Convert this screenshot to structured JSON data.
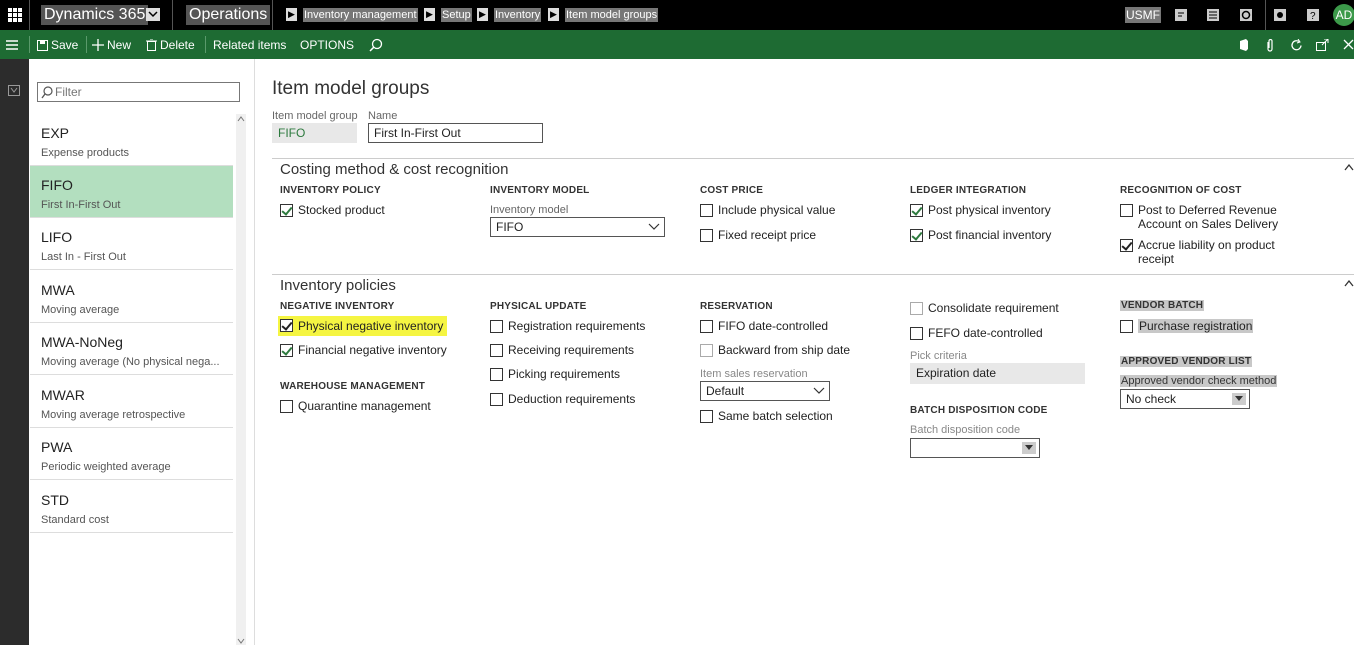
{
  "topbar": {
    "product": "Dynamics 365",
    "app": "Operations",
    "breadcrumb": [
      "Inventory management",
      "Setup",
      "Inventory",
      "Item model groups"
    ],
    "company": "USMF",
    "user_initials": "AD"
  },
  "actions": {
    "save": "Save",
    "new": "New",
    "delete": "Delete",
    "related": "Related items",
    "options": "OPTIONS"
  },
  "list": {
    "filter_placeholder": "Filter",
    "items": [
      {
        "code": "EXP",
        "name": "Expense products"
      },
      {
        "code": "FIFO",
        "name": "First In-First Out"
      },
      {
        "code": "LIFO",
        "name": "Last In - First Out"
      },
      {
        "code": "MWA",
        "name": "Moving average"
      },
      {
        "code": "MWA-NoNeg",
        "name": "Moving average (No physical nega..."
      },
      {
        "code": "MWAR",
        "name": "Moving average retrospective"
      },
      {
        "code": "PWA",
        "name": "Periodic weighted average"
      },
      {
        "code": "STD",
        "name": "Standard cost"
      }
    ],
    "selected": "FIFO"
  },
  "page": {
    "title": "Item model groups",
    "group_label": "Item model group",
    "group_value": "FIFO",
    "name_label": "Name",
    "name_value": "First In-First Out"
  },
  "costing": {
    "title": "Costing method & cost recognition",
    "inventory_policy": {
      "header": "INVENTORY POLICY",
      "stocked": "Stocked product"
    },
    "inventory_model": {
      "header": "INVENTORY MODEL",
      "label": "Inventory model",
      "value": "FIFO"
    },
    "cost_price": {
      "header": "COST PRICE",
      "include_physical": "Include physical value",
      "fixed_receipt": "Fixed receipt price"
    },
    "ledger": {
      "header": "LEDGER INTEGRATION",
      "post_physical": "Post physical inventory",
      "post_financial": "Post financial inventory"
    },
    "recognition": {
      "header": "RECOGNITION OF COST",
      "deferred_1": "Post to Deferred Revenue",
      "deferred_2": "Account on Sales Delivery",
      "accrue_1": "Accrue liability on product",
      "accrue_2": "receipt"
    }
  },
  "policies": {
    "title": "Inventory policies",
    "negative": {
      "header": "NEGATIVE INVENTORY",
      "physical": "Physical negative inventory",
      "financial": "Financial negative inventory"
    },
    "warehouse": {
      "header": "WAREHOUSE MANAGEMENT",
      "quarantine": "Quarantine management"
    },
    "physical_update": {
      "header": "PHYSICAL UPDATE",
      "registration": "Registration requirements",
      "receiving": "Receiving requirements",
      "picking": "Picking requirements",
      "deduction": "Deduction requirements"
    },
    "reservation": {
      "header": "RESERVATION",
      "fifo_date": "FIFO date-controlled",
      "backward": "Backward from ship date",
      "sales_res_label": "Item sales reservation",
      "sales_res_value": "Default",
      "same_batch": "Same batch selection"
    },
    "misc": {
      "consolidate": "Consolidate requirement",
      "fefo": "FEFO date-controlled",
      "pick_label": "Pick criteria",
      "pick_value": "Expiration date",
      "batch_header": "BATCH DISPOSITION CODE",
      "batch_label": "Batch disposition code",
      "batch_value": ""
    },
    "vendor": {
      "batch_header": "VENDOR BATCH",
      "purchase_reg": "Purchase registration",
      "approved_header": "APPROVED VENDOR LIST",
      "check_label": "Approved vendor check method",
      "check_value": "No check"
    }
  },
  "colors": {
    "actionbar": "#1e6b33",
    "selected_row": "#b3dfbf",
    "highlight": "#f5f542"
  }
}
